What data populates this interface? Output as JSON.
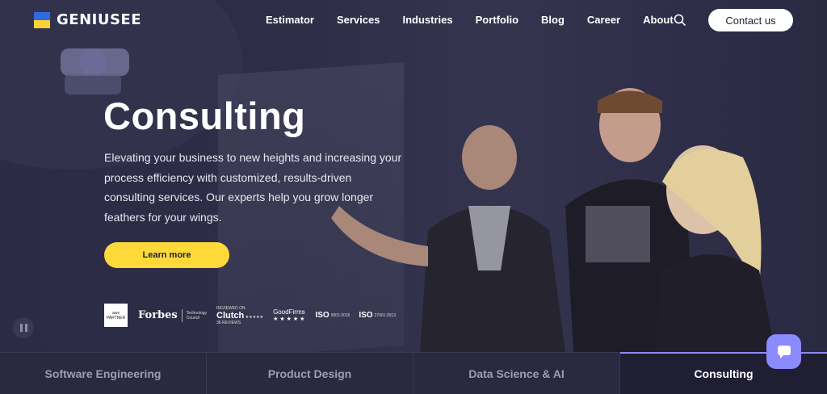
{
  "brand": {
    "name": "GENIUSEE",
    "flag_top": "#2f6be0",
    "flag_bottom": "#f9d236"
  },
  "nav": {
    "items": [
      "Estimator",
      "Services",
      "Industries",
      "Portfolio",
      "Blog",
      "Career",
      "About"
    ],
    "search_icon": "search-icon",
    "contact_label": "Contact us"
  },
  "hero": {
    "title": "Consulting",
    "description": "Elevating your business to new heights and increasing your process efficiency with customized, results-driven consulting services. Our experts help you grow longer feathers for your wings.",
    "cta_label": "Learn more",
    "cta_color": "#ffd93a"
  },
  "badges": {
    "aws": [
      "aws",
      "PARTNER"
    ],
    "forbes": {
      "name": "Forbes",
      "sub": [
        "Technology",
        "Council"
      ]
    },
    "clutch": {
      "top": "REVIEWED ON",
      "name": "Clutch",
      "stars": "★★★★★",
      "reviews": "36 REVIEWS"
    },
    "goodfirms": {
      "name": "GoodFirms",
      "stars": "★★★★★"
    },
    "iso1": {
      "mark": "ISO",
      "num": "9001:2015"
    },
    "iso2": {
      "mark": "ISO",
      "num": "27001:2013"
    }
  },
  "tabs": [
    {
      "label": "Software Engineering"
    },
    {
      "label": "Product Design"
    },
    {
      "label": "Data Science & AI"
    },
    {
      "label": "Consulting"
    }
  ],
  "chat_icon": "chat-bubble-icon",
  "pause_icon": "pause-icon"
}
